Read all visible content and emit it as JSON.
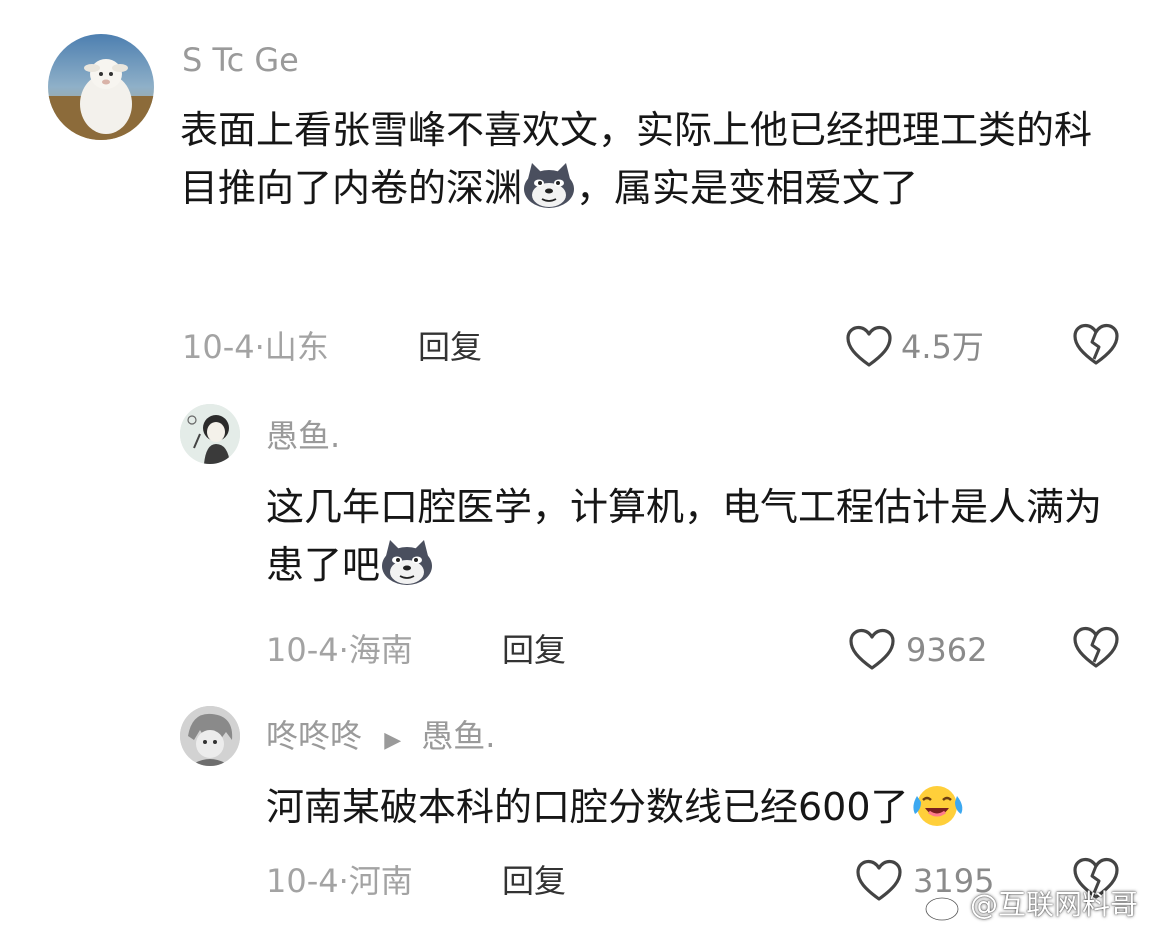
{
  "comments": [
    {
      "username": "S Tc Ge",
      "text_part1": "表面上看张雪峰不喜欢文，实际上他已经把理工类的科目推向了内卷的深渊",
      "emoji1": "husky-dog-emoji",
      "text_part2": "，属实是变相爱文了",
      "date": "10-4",
      "sep": "·",
      "location": "山东",
      "reply_label": "回复",
      "likes": "4.5万"
    },
    {
      "username": "愚鱼.",
      "text_part1": "这几年口腔医学，计算机，电气工程估计是人满为患了吧",
      "emoji1": "husky-dog-emoji",
      "date": "10-4",
      "sep": "·",
      "location": "海南",
      "reply_label": "回复",
      "likes": "9362"
    },
    {
      "username": "咚咚咚",
      "reply_to": "愚鱼.",
      "text_part1": "河南某破本科的口腔分数线已经600了",
      "emoji1": "laughing-crying-emoji",
      "date": "10-4",
      "sep": "·",
      "location": "河南",
      "reply_label": "回复",
      "likes": "3195"
    }
  ],
  "watermark": "@互联网料哥",
  "colors": {
    "muted": "#a3a3a3",
    "text": "#161616",
    "icon": "#444444"
  }
}
